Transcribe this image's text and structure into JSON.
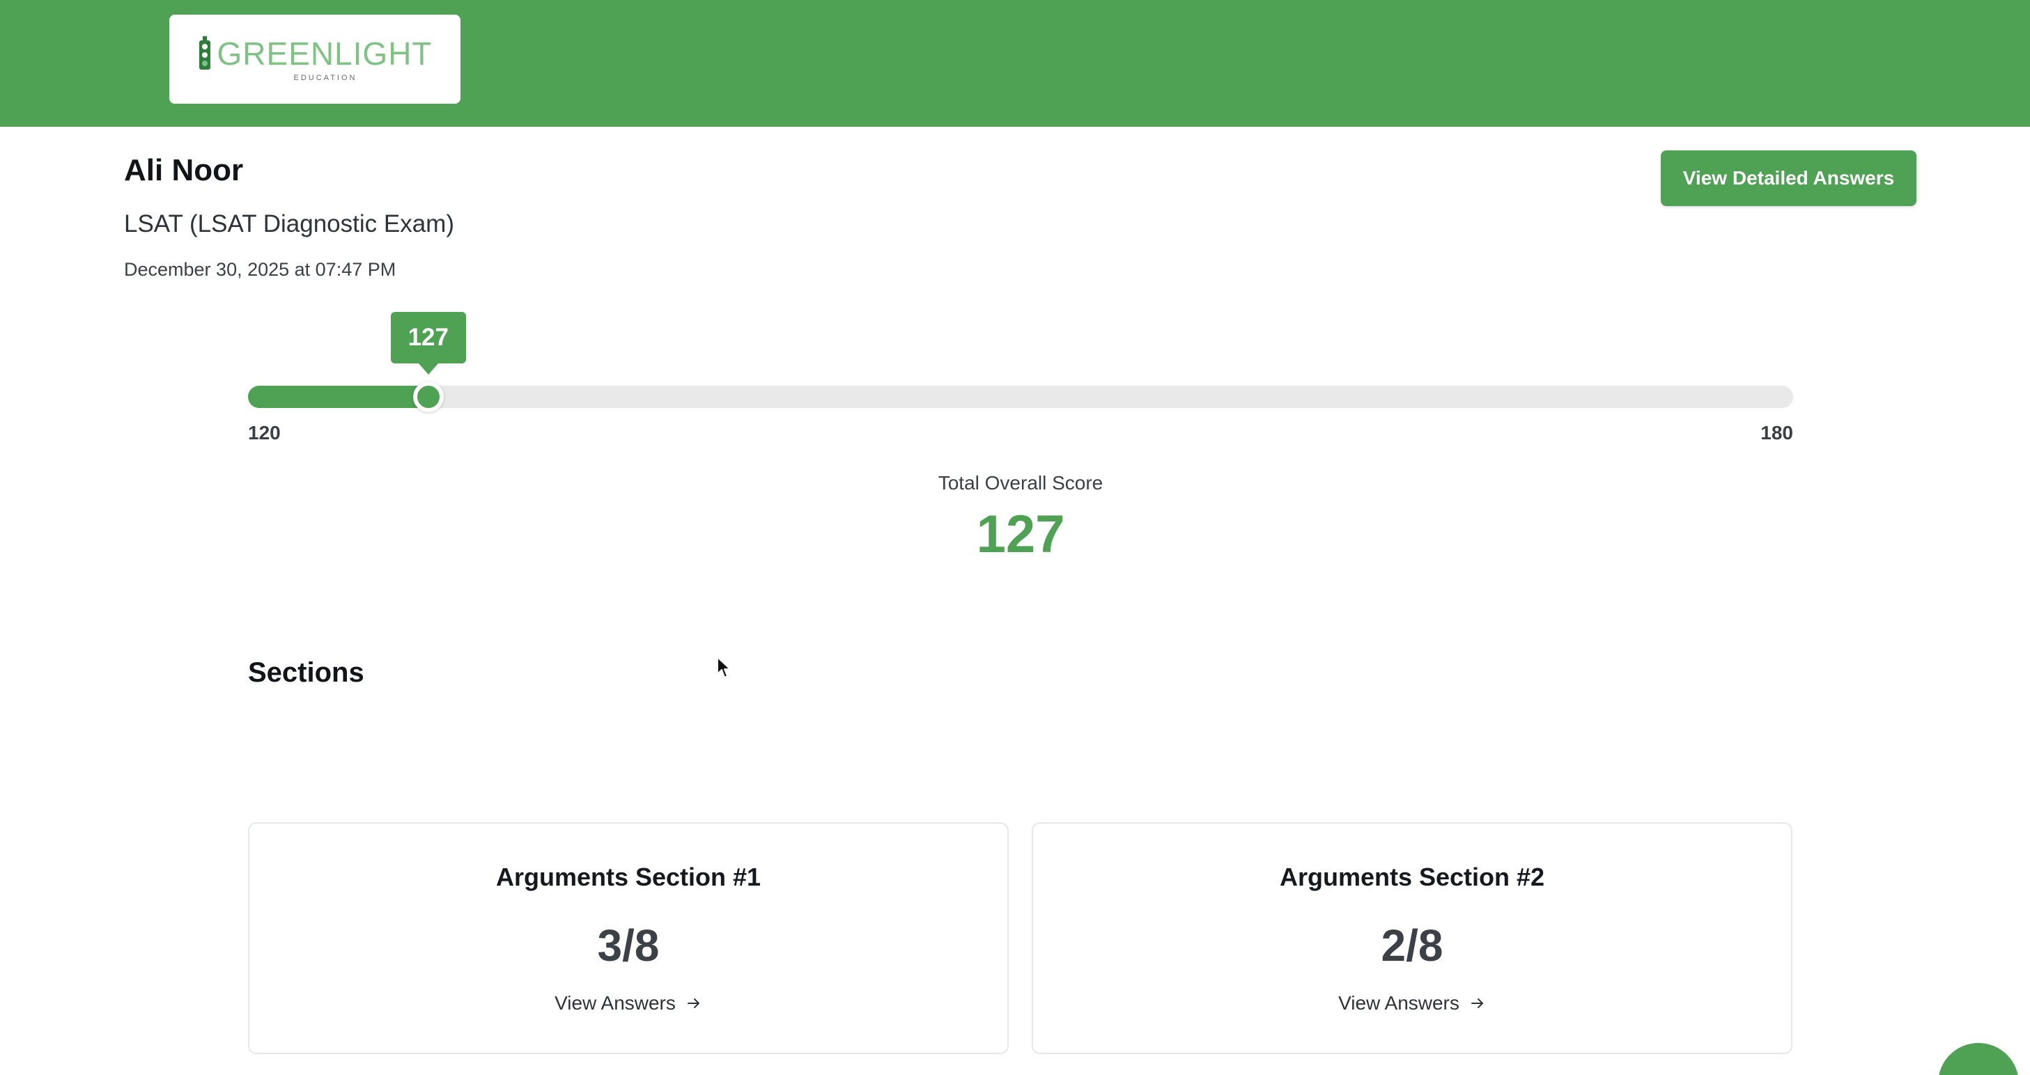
{
  "header": {
    "logo_word": "GREENLIGHT",
    "logo_sub": "EDUCATION",
    "brand_color": "#4fa153"
  },
  "student": {
    "name": "Ali Noor",
    "exam": "LSAT (LSAT Diagnostic Exam)",
    "date": "December 30, 2025 at 07:47 PM"
  },
  "actions": {
    "view_detailed_answers": "View Detailed Answers"
  },
  "score": {
    "min": 120,
    "max": 180,
    "value": 127,
    "min_label": "120",
    "max_label": "180",
    "tooltip": "127",
    "total_label": "Total Overall Score",
    "total_value": "127"
  },
  "sections": {
    "heading": "Sections",
    "items": [
      {
        "title": "Arguments Section #1",
        "score": "3/8",
        "link_label": "View Answers",
        "link_icon": "arrow-right-icon"
      },
      {
        "title": "Arguments Section #2",
        "score": "2/8",
        "link_label": "View Answers",
        "link_icon": "arrow-right-icon"
      }
    ]
  }
}
